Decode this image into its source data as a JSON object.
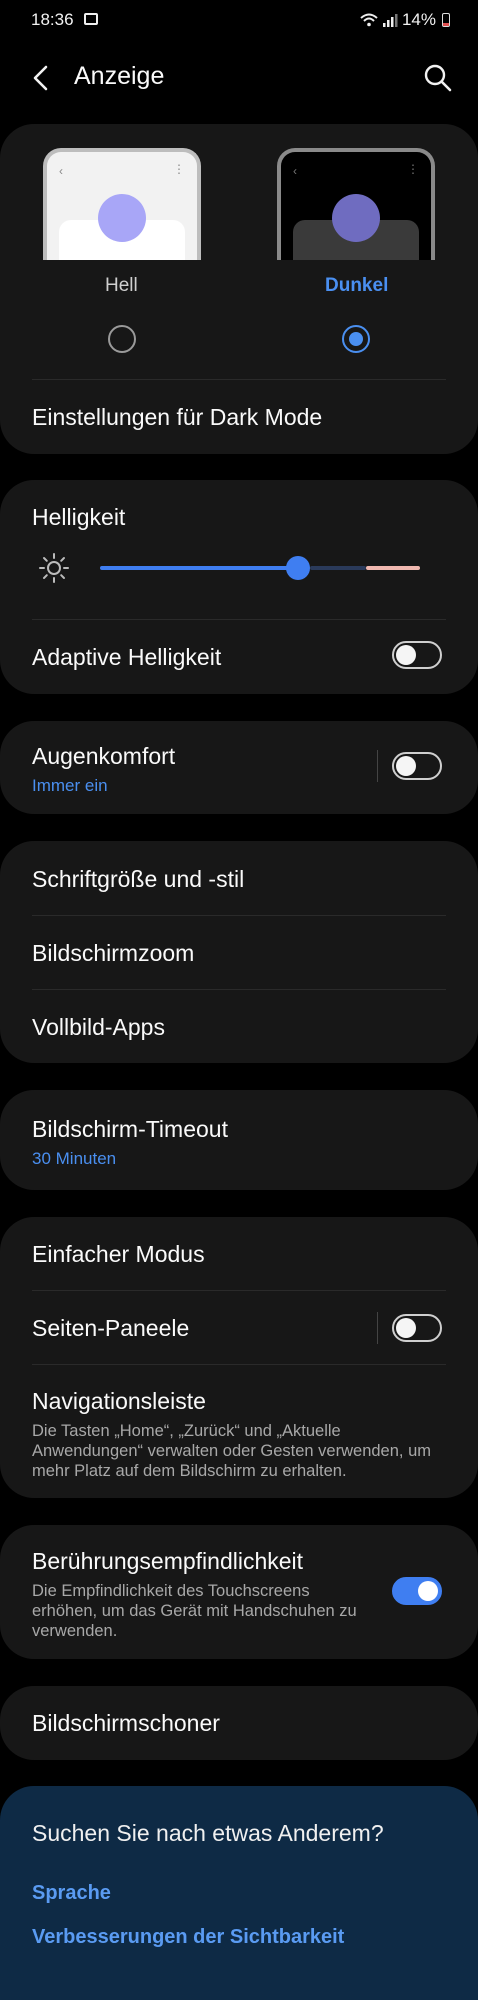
{
  "status_bar": {
    "time": "18:36",
    "battery": "14%"
  },
  "header": {
    "title": "Anzeige"
  },
  "theme": {
    "light_label": "Hell",
    "dark_label": "Dunkel",
    "selected": "Dunkel",
    "dark_mode_settings": "Einstellungen für Dark Mode"
  },
  "brightness": {
    "label": "Helligkeit",
    "level_fraction": 0.62,
    "adaptive_label": "Adaptive Helligkeit",
    "adaptive_on": false
  },
  "eye_comfort": {
    "label": "Augenkomfort",
    "sub": "Immer ein",
    "on": false
  },
  "fonts_group": {
    "font_label": "Schriftgröße und -stil",
    "zoom_label": "Bildschirmzoom",
    "fullscreen_label": "Vollbild-Apps"
  },
  "timeout": {
    "label": "Bildschirm-Timeout",
    "sub": "30 Minuten"
  },
  "misc_group": {
    "easy_mode": "Einfacher Modus",
    "edge_panels": "Seiten-Paneele",
    "edge_panels_on": false,
    "nav_bar": "Navigationsleiste",
    "nav_bar_desc": "Die Tasten „Home“, „Zurück“ und „Aktuelle Anwendungen“ verwalten oder Gesten verwenden, um mehr Platz auf dem Bildschirm zu erhalten."
  },
  "touch": {
    "label": "Berührungsempfindlichkeit",
    "desc": "Die Empfindlichkeit des Touchscreens erhöhen, um das Gerät mit Handschuhen zu verwenden.",
    "on": true
  },
  "screensaver": {
    "label": "Bildschirmschoner"
  },
  "suggestions": {
    "title": "Suchen Sie nach etwas Anderem?",
    "link1": "Sprache",
    "link2": "Verbesserungen der Sichtbarkeit"
  },
  "colors": {
    "accent": "#3f7ef1",
    "link": "#5a9bf2",
    "card": "#171717"
  }
}
